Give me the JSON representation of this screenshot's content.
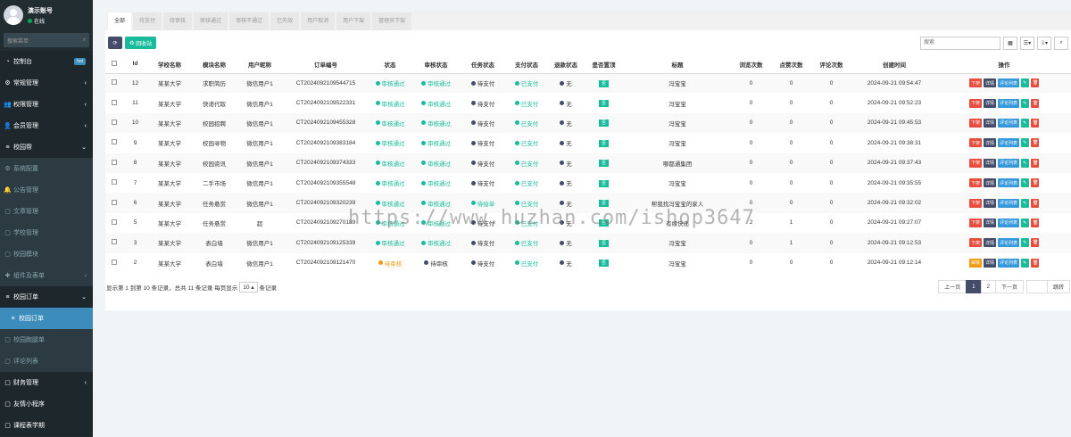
{
  "user": {
    "name": "演示账号",
    "status": "在线"
  },
  "search": {
    "placeholder": "搜索菜单"
  },
  "nav": [
    {
      "label": "控制台",
      "icon": "dashboard-icon",
      "badge": "hot"
    },
    {
      "label": "常规管理",
      "icon": "cogs-icon"
    },
    {
      "label": "权限管理",
      "icon": "group-icon"
    },
    {
      "label": "会员管理",
      "icon": "user-icon"
    },
    {
      "label": "校园帮",
      "icon": "list-icon"
    },
    {
      "label": "系统配置",
      "icon": "cog-icon"
    },
    {
      "label": "公告管理",
      "icon": "bell-icon"
    },
    {
      "label": "文章管理",
      "icon": "file-icon"
    },
    {
      "label": "学校管理",
      "icon": "file-icon"
    },
    {
      "label": "校园模块",
      "icon": "file-icon"
    },
    {
      "label": "组件及表单",
      "icon": "puzzle-icon"
    },
    {
      "label": "校园订单",
      "icon": "list-icon"
    },
    {
      "label": "校园订单",
      "icon": "list-icon"
    },
    {
      "label": "校园跑腿单",
      "icon": "file-icon"
    },
    {
      "label": "评论列表",
      "icon": "file-icon"
    },
    {
      "label": "财务管理",
      "icon": "file-icon"
    },
    {
      "label": "友情小程序",
      "icon": "file-icon"
    },
    {
      "label": "课程表学期",
      "icon": "file-icon"
    }
  ],
  "tabs": [
    "全部",
    "待支付",
    "待审核",
    "审核通过",
    "审核不通过",
    "已失效",
    "用户取消",
    "用户下架",
    "管理员下架"
  ],
  "toolbar": {
    "recycle": "回收站",
    "search_placeholder": "搜索"
  },
  "columns": [
    "Id",
    "学校名称",
    "模块名称",
    "用户昵称",
    "订单编号",
    "状态",
    "审核状态",
    "任务状态",
    "支付状态",
    "退款状态",
    "是否置顶",
    "标题",
    "浏览次数",
    "点赞次数",
    "评论次数",
    "创建时间",
    "操作"
  ],
  "rows": [
    {
      "id": "12",
      "school": "某某大学",
      "module": "求职简历",
      "user": "微信用户1",
      "order": "CT2024092109544715",
      "status": "审核通过",
      "audit": "审核通过",
      "task": "待支付",
      "pay": "已支付",
      "refund": "无",
      "top": "否",
      "title": "冯宝宝",
      "views": "0",
      "likes": "0",
      "comments": "0",
      "created": "2024-09-21 09:54:47",
      "first": "下架"
    },
    {
      "id": "11",
      "school": "某某大学",
      "module": "快递代取",
      "user": "微信用户1",
      "order": "CT2024092109522331",
      "status": "审核通过",
      "audit": "审核通过",
      "task": "待支付",
      "pay": "已支付",
      "refund": "无",
      "top": "否",
      "title": "冯宝宝",
      "views": "0",
      "likes": "0",
      "comments": "0",
      "created": "2024-09-21 09:52:23",
      "first": "下架"
    },
    {
      "id": "10",
      "school": "某某大学",
      "module": "校园招聘",
      "user": "微信用户1",
      "order": "CT2024092109455328",
      "status": "审核通过",
      "audit": "审核通过",
      "task": "待支付",
      "pay": "已支付",
      "refund": "无",
      "top": "否",
      "title": "冯宝宝",
      "views": "0",
      "likes": "0",
      "comments": "0",
      "created": "2024-09-21 09:45:53",
      "first": "下架"
    },
    {
      "id": "9",
      "school": "某某大学",
      "module": "校园寻物",
      "user": "微信用户1",
      "order": "CT2024092109383184",
      "status": "审核通过",
      "audit": "审核通过",
      "task": "待支付",
      "pay": "已支付",
      "refund": "无",
      "top": "否",
      "title": "冯宝宝",
      "views": "0",
      "likes": "0",
      "comments": "0",
      "created": "2024-09-21 09:38:31",
      "first": "下架"
    },
    {
      "id": "8",
      "school": "某某大学",
      "module": "校园资讯",
      "user": "微信用户1",
      "order": "CT2024092109374333",
      "status": "审核通过",
      "audit": "审核通过",
      "task": "待支付",
      "pay": "已支付",
      "refund": "无",
      "top": "否",
      "title": "哪都通集团",
      "views": "0",
      "likes": "0",
      "comments": "0",
      "created": "2024-09-21 09:37:43",
      "first": "下架"
    },
    {
      "id": "7",
      "school": "某某大学",
      "module": "二手市场",
      "user": "微信用户1",
      "order": "CT2024092109355548",
      "status": "审核通过",
      "audit": "审核通过",
      "task": "待支付",
      "pay": "已支付",
      "refund": "无",
      "top": "否",
      "title": "冯宝宝",
      "views": "0",
      "likes": "0",
      "comments": "0",
      "created": "2024-09-21 09:35:55",
      "first": "下架"
    },
    {
      "id": "6",
      "school": "某某大学",
      "module": "任务悬赏",
      "user": "微信用户1",
      "order": "CT2024092109320239",
      "status": "审核通过",
      "audit": "审核通过",
      "task": "待接单",
      "pay": "已支付",
      "refund": "无",
      "top": "否",
      "title": "帮我找冯宝宝的家人",
      "views": "0",
      "likes": "0",
      "comments": "0",
      "created": "2024-09-21 09:32:02",
      "first": "下架"
    },
    {
      "id": "5",
      "school": "某某大学",
      "module": "任务悬赏",
      "user": "超",
      "order": "CT2024092109270189",
      "status": "审核通过",
      "audit": "审核通过",
      "task": "待支付",
      "pay": "已支付",
      "refund": "无",
      "top": "否",
      "title": "有缘快递",
      "views": "2",
      "likes": "1",
      "comments": "0",
      "created": "2024-09-21 09:27:07",
      "first": "下架"
    },
    {
      "id": "3",
      "school": "某某大学",
      "module": "表白墙",
      "user": "微信用户1",
      "order": "CT2024092109125339",
      "status": "审核通过",
      "audit": "审核通过",
      "task": "待支付",
      "pay": "已支付",
      "refund": "无",
      "top": "否",
      "title": "冯宝宝",
      "views": "0",
      "likes": "1",
      "comments": "0",
      "created": "2024-09-21 09:12:53",
      "first": "下架"
    },
    {
      "id": "2",
      "school": "某某大学",
      "module": "表白墙",
      "user": "微信用户1",
      "order": "CT2024092109121470",
      "status": "待审核",
      "audit": "待审核",
      "task": "待支付",
      "pay": "已支付",
      "refund": "无",
      "top": "否",
      "title": "冯宝宝",
      "views": "0",
      "likes": "0",
      "comments": "0",
      "created": "2024-09-21 09:12:14",
      "first": "审核"
    }
  ],
  "ops": {
    "detail": "详情",
    "comments": "评论列表"
  },
  "footer": {
    "summary": "显示第 1 到第 10 条记录，总共 11 条记录 每页显示",
    "page_size": "10",
    "suffix": "条记录"
  },
  "pager": {
    "prev": "上一页",
    "p1": "1",
    "p2": "2",
    "next": "下一页",
    "jump": "跳转"
  },
  "watermark": "https://www.huzhan.com/ishop3647"
}
